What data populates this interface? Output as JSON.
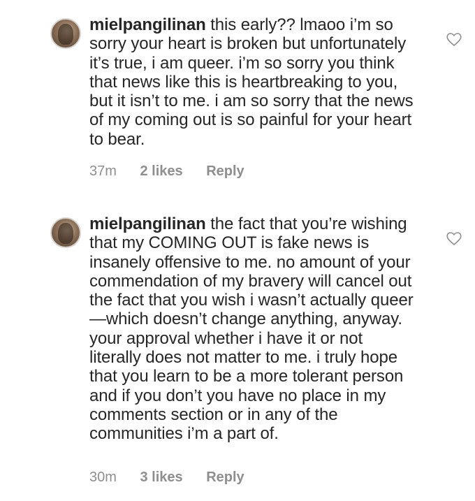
{
  "comments": [
    {
      "username": "mielpangilinan",
      "text": "this early?? lmaoo i’m so sorry your heart is broken but unfortunately it’s true, i am queer. i’m so sorry you think that news like this is heartbreaking to you, but it isn’t to me. i am so sorry that the news of my coming out is so painful for your heart to bear.",
      "time": "37m",
      "likes": "2 likes",
      "reply": "Reply"
    },
    {
      "username": "mielpangilinan",
      "text": "the fact that you’re wishing that my COMING OUT is fake news is insanely offensive to me. no amount of your commendation of my bravery will cancel out the fact that you wish i wasn’t actually queer—which doesn’t change anything, anyway. your approval whether i have it or not literally does not matter to me. i truly hope that you learn to be a more tolerant person and if you don’t you have no place in my comments section or in any of the communities i’m a part of.",
      "time": "30m",
      "likes": "3 likes",
      "reply": "Reply"
    }
  ],
  "icons": {
    "like": "heart-outline-icon",
    "avatar": "profile-avatar"
  },
  "colors": {
    "text": "#262626",
    "meta": "#8e8e8e",
    "background": "#ffffff"
  }
}
